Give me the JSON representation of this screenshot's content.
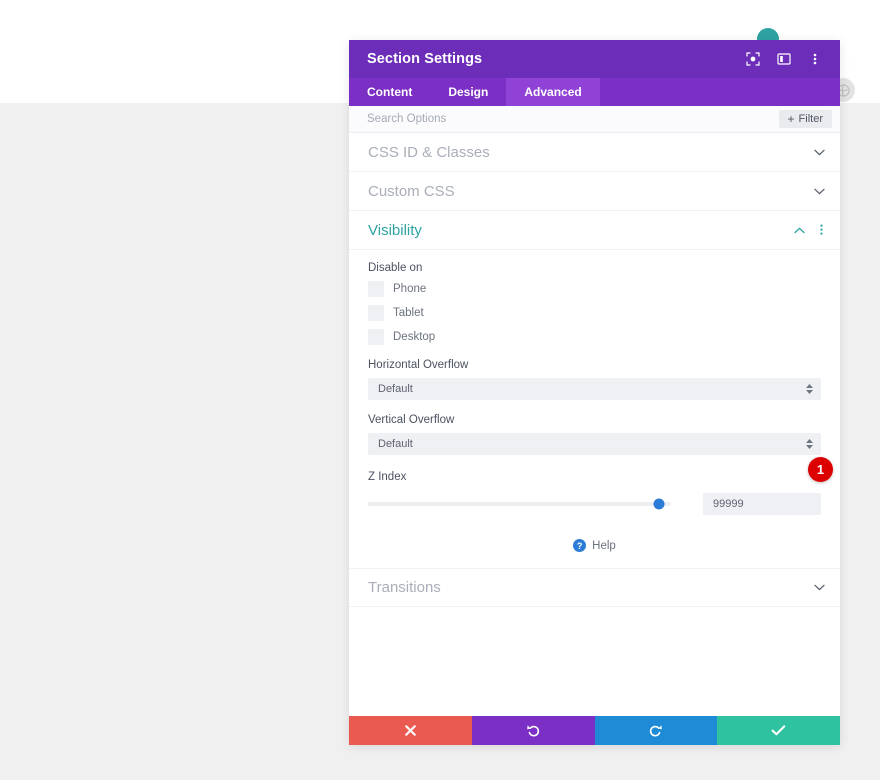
{
  "panel": {
    "title": "Section Settings",
    "header_icons": [
      {
        "name": "focus-target-icon"
      },
      {
        "name": "panel-layout-icon"
      },
      {
        "name": "more-options-icon"
      }
    ],
    "tabs": [
      {
        "label": "Content",
        "active": false
      },
      {
        "label": "Design",
        "active": false
      },
      {
        "label": "Advanced",
        "active": true
      }
    ],
    "search": {
      "placeholder": "Search Options",
      "value": ""
    },
    "filter_button": {
      "label": "Filter",
      "plus": "+"
    },
    "sections": [
      {
        "name": "CSS ID & Classes",
        "open": false
      },
      {
        "name": "Custom CSS",
        "open": false
      },
      {
        "name": "Visibility",
        "open": true
      },
      {
        "name": "Transitions",
        "open": false
      }
    ],
    "visibility": {
      "disable_on_label": "Disable on",
      "devices": [
        {
          "label": "Phone",
          "checked": false
        },
        {
          "label": "Tablet",
          "checked": false
        },
        {
          "label": "Desktop",
          "checked": false
        }
      ],
      "horizontal_overflow": {
        "label": "Horizontal Overflow",
        "value": "Default"
      },
      "vertical_overflow": {
        "label": "Vertical Overflow",
        "value": "Default"
      },
      "z_index": {
        "label": "Z Index",
        "value": "99999",
        "slider_percent": 96
      }
    },
    "help": {
      "label": "Help",
      "icon_glyph": "?"
    },
    "actions": [
      {
        "name": "cancel",
        "glyph": "close-icon"
      },
      {
        "name": "undo",
        "glyph": "undo-icon"
      },
      {
        "name": "redo",
        "glyph": "redo-icon"
      },
      {
        "name": "save",
        "glyph": "check-icon"
      }
    ]
  },
  "annotation": {
    "step_number": "1"
  },
  "colors": {
    "header_purple": "#6c2eb9",
    "tab_purple": "#7b2fc4",
    "tab_active_purple": "#9041d6",
    "accent_teal": "#2ea3a3",
    "slider_blue": "#2a7cd6",
    "badge_red": "#dd0000",
    "action_cancel": "#eb5a51",
    "action_undo": "#7b2fc4",
    "action_redo": "#1f8ad5",
    "action_save": "#2ec2a0"
  }
}
